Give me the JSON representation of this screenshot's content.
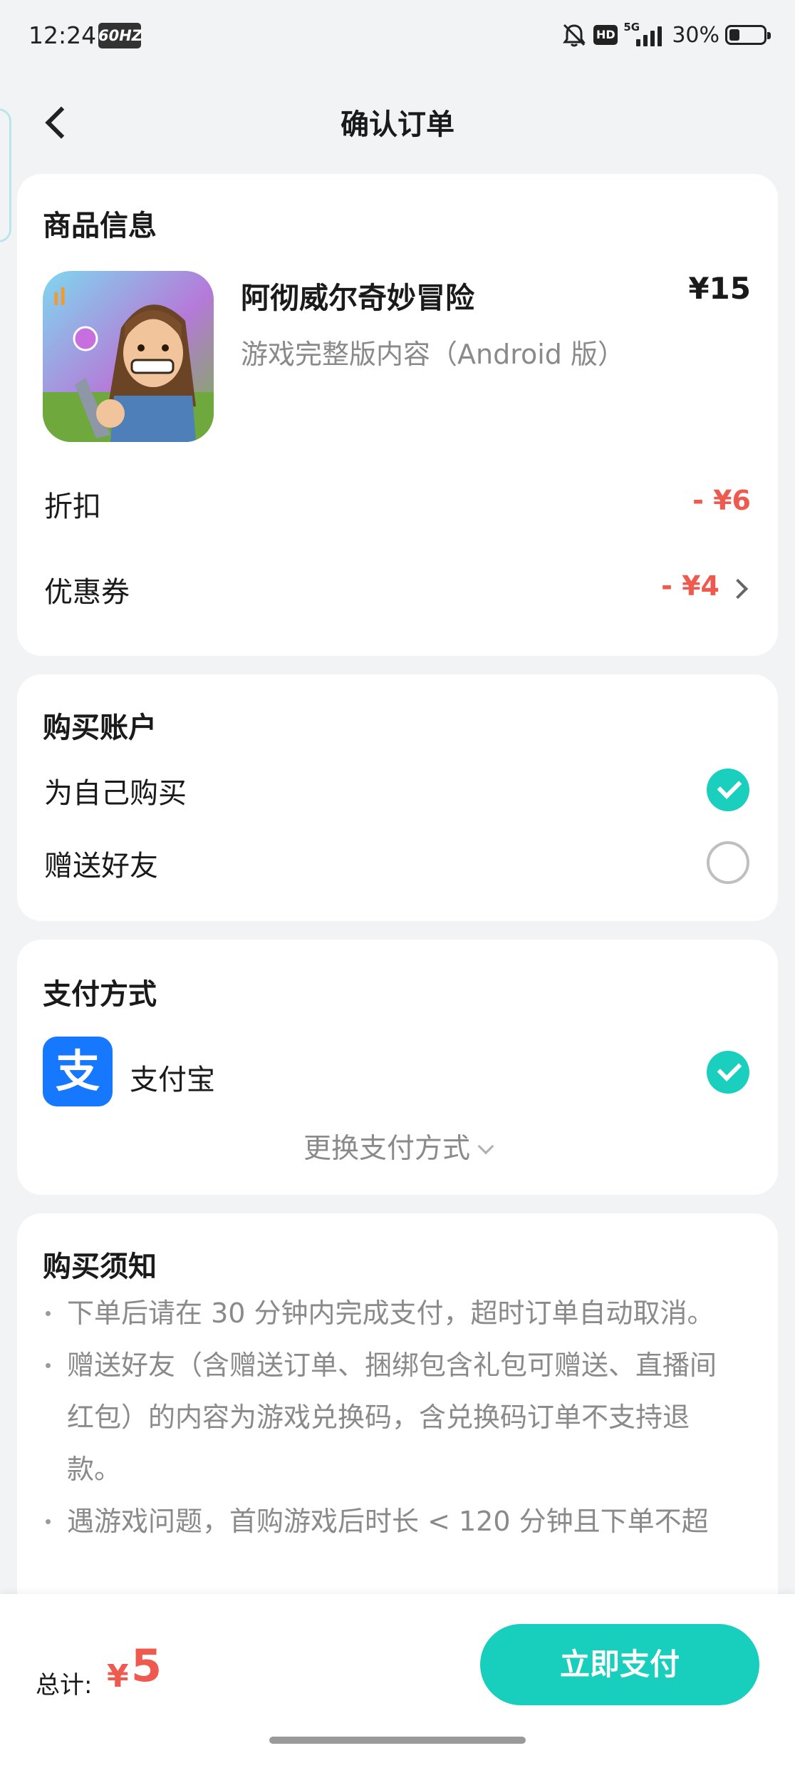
{
  "status_bar": {
    "time": "12:24",
    "refresh_rate": "60HZ",
    "hd": "HD",
    "network": "5G",
    "battery_percent": "30%",
    "battery_level": 0.3,
    "icons": [
      "bell-mute-icon",
      "hd-icon",
      "signal-5g-icon",
      "battery-icon"
    ]
  },
  "header": {
    "title": "确认订单"
  },
  "product_section": {
    "title": "商品信息",
    "name": "阿彻威尔奇妙冒险",
    "description": "游戏完整版内容（Android 版）",
    "price": "¥15",
    "discount_label": "折扣",
    "discount_value": "- ¥6",
    "coupon_label": "优惠券",
    "coupon_value": "- ¥4"
  },
  "account_section": {
    "title": "购买账户",
    "options": [
      {
        "label": "为自己购买",
        "selected": true
      },
      {
        "label": "赠送好友",
        "selected": false
      }
    ]
  },
  "payment_section": {
    "title": "支付方式",
    "method_icon_text": "支",
    "method_name": "支付宝",
    "change_label": "更换支付方式"
  },
  "notice_section": {
    "title": "购买须知",
    "items": [
      "下单后请在 30 分钟内完成支付，超时订单自动取消。",
      "赠送好友（含赠送订单、捆绑包含礼包可赠送、直播间红包）的内容为游戏兑换码，含兑换码订单不支持退款。",
      "遇游戏问题，首购游戏后时长 < 120 分钟且下单不超"
    ]
  },
  "bottom_bar": {
    "total_label": "总计:",
    "currency": "¥",
    "total_amount": "5",
    "pay_button": "立即支付"
  },
  "colors": {
    "accent": "#18cfbd",
    "price_red": "#ef5a4f",
    "alipay_blue": "#1677ff",
    "background": "#f2f3f5"
  }
}
